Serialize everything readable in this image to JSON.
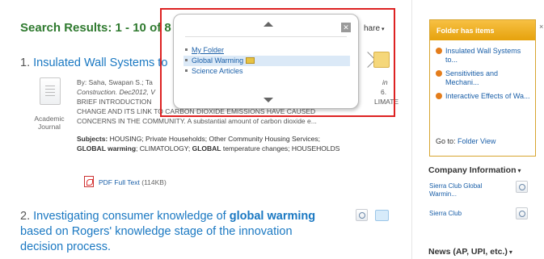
{
  "results": {
    "heading": "Search Results: 1 - 10 of 8",
    "share_label": "hare",
    "share_caret": "▾"
  },
  "result1": {
    "number": "1.",
    "title_fragment": "Insulated Wall Systems to",
    "doc_type": "Academic Journal",
    "byline_prefix": "By: Saha, Swapan S.; Ta",
    "byline_tail": "in",
    "source_prefix": "Construction. Dec2012, V",
    "source_tail": "6.",
    "abstract_line1_prefix": "BRIEF INTRODUCTION",
    "abstract_line1_tail": "LIMATE",
    "abstract_line2": "CHANGE AND ITS LINK TO CARBON DIOXIDE EMISSIONS HAVE CAUSED",
    "abstract_line3": "CONCERNS IN THE COMMUNITY. A substantial amount of carbon dioxide e...",
    "subjects_label": "Subjects:",
    "subjects_text1": "HOUSING; Private Households; Other Community Housing Services;",
    "subjects_bold1": "GLOBAL warming",
    "subjects_text2": "; CLIMATOLOGY;",
    "subjects_bold2": "GLOBAL",
    "subjects_text3": "temperature changes; HOUSEHOLDS",
    "pdf_label": "PDF Full Text",
    "pdf_size": "(114KB)"
  },
  "result2": {
    "number": "2.",
    "title_part1": "Investigating consumer knowledge of",
    "title_bold": "global warming",
    "title_part2": "based on Rogers' knowledge stage of the innovation decision process."
  },
  "popup": {
    "items": [
      {
        "label": "My Folder"
      },
      {
        "label": "Global Warming"
      },
      {
        "label": "Science Articles"
      }
    ],
    "close_glyph": "✕"
  },
  "folder_box": {
    "header": "Folder has items",
    "items": [
      {
        "label": "Insulated Wall Systems to..."
      },
      {
        "label": "Sensitivities and Mechani..."
      },
      {
        "label": "Interactive Effects of Wa..."
      }
    ],
    "go_prefix": "Go to:",
    "go_link": "Folder View"
  },
  "sidebar": {
    "company_heading": "Company Information",
    "company_items": [
      {
        "label": "Sierra Club Global Warmin..."
      },
      {
        "label": "Sierra Club"
      }
    ],
    "news_heading": "News (AP, UPI, etc.)",
    "caret": "▾",
    "edge_mark": "×"
  },
  "colors": {
    "heading_green": "#2f7a2f",
    "link_blue": "#1a78c2",
    "popup_border_red": "#dd2222",
    "folder_orange": "#e6a20c"
  }
}
